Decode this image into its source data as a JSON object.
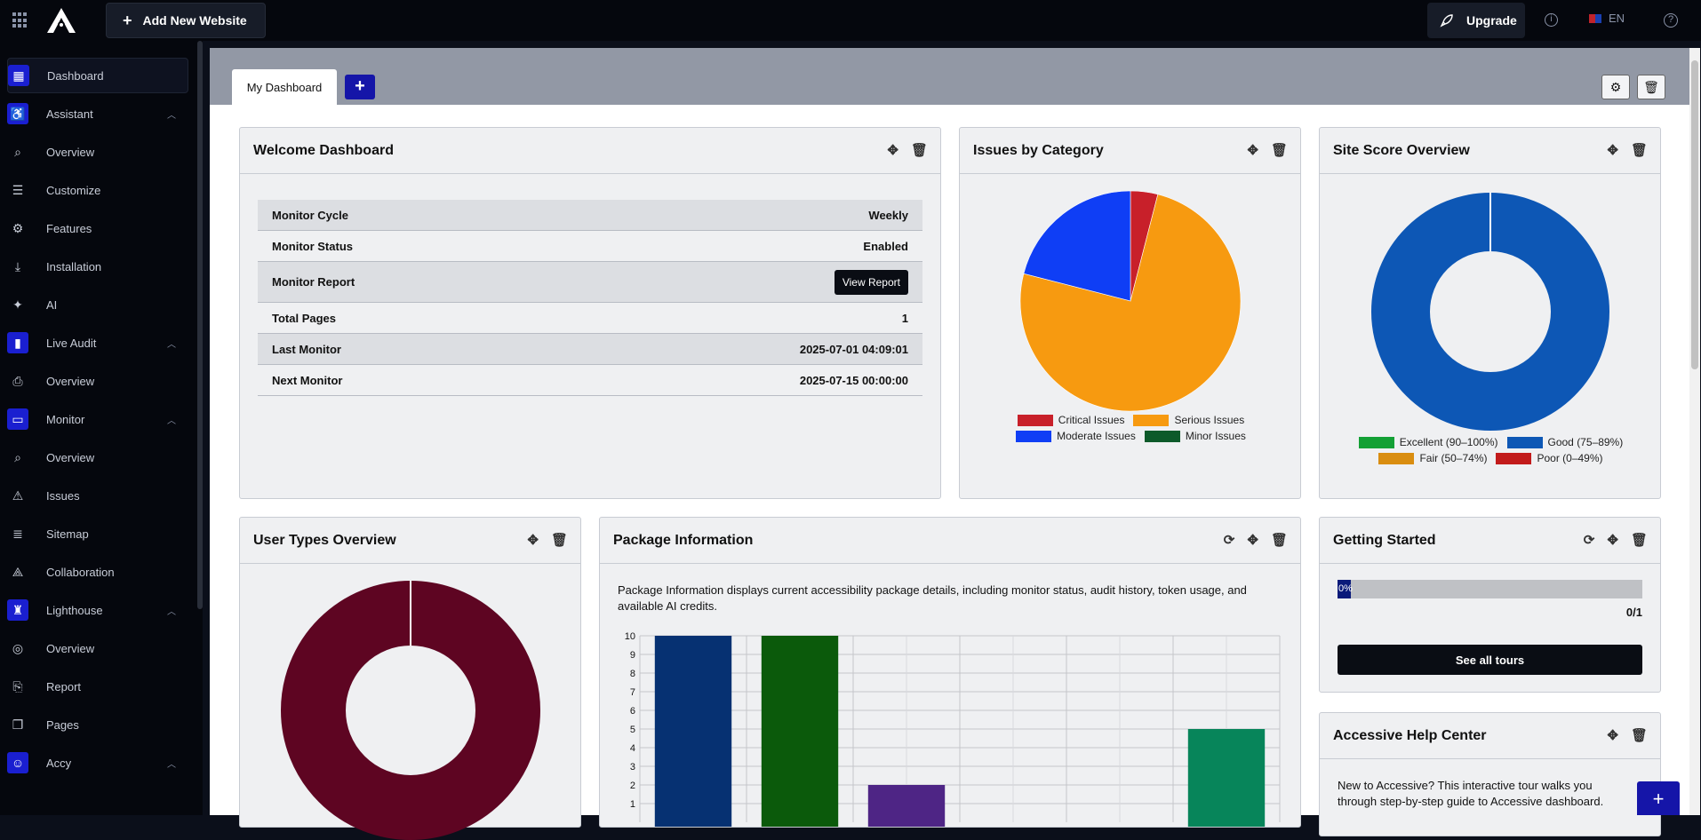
{
  "topbar": {
    "add_website_label": "Add New Website",
    "upgrade_label": "Upgrade",
    "language": "EN"
  },
  "sidebar": {
    "items": [
      {
        "label": "Dashboard",
        "icon": "dashboard-icon",
        "kind": "active"
      },
      {
        "label": "Assistant",
        "icon": "accessibility-icon",
        "kind": "section"
      },
      {
        "label": "Overview",
        "icon": "page-search-icon",
        "kind": "sub"
      },
      {
        "label": "Customize",
        "icon": "sliders-icon",
        "kind": "sub"
      },
      {
        "label": "Features",
        "icon": "gear-icon",
        "kind": "sub"
      },
      {
        "label": "Installation",
        "icon": "install-icon",
        "kind": "sub"
      },
      {
        "label": "AI",
        "icon": "sparkle-icon",
        "kind": "sub"
      },
      {
        "label": "Live Audit",
        "icon": "bar-chart-icon",
        "kind": "section"
      },
      {
        "label": "Overview",
        "icon": "doc-search-icon",
        "kind": "sub"
      },
      {
        "label": "Monitor",
        "icon": "monitor-icon",
        "kind": "section"
      },
      {
        "label": "Overview",
        "icon": "magnify-icon",
        "kind": "sub"
      },
      {
        "label": "Issues",
        "icon": "warning-icon",
        "kind": "sub"
      },
      {
        "label": "Sitemap",
        "icon": "list-icon",
        "kind": "sub"
      },
      {
        "label": "Collaboration",
        "icon": "collab-icon",
        "kind": "sub"
      },
      {
        "label": "Lighthouse",
        "icon": "lighthouse-icon",
        "kind": "section"
      },
      {
        "label": "Overview",
        "icon": "gauge-icon",
        "kind": "sub"
      },
      {
        "label": "Report",
        "icon": "report-icon",
        "kind": "sub"
      },
      {
        "label": "Pages",
        "icon": "pages-icon",
        "kind": "sub"
      },
      {
        "label": "Accy",
        "icon": "robot-icon",
        "kind": "section"
      }
    ]
  },
  "tabs": {
    "active": "My Dashboard"
  },
  "welcome": {
    "title": "Welcome Dashboard",
    "rows": [
      {
        "label": "Monitor Cycle",
        "value": "Weekly"
      },
      {
        "label": "Monitor Status",
        "value": "Enabled"
      },
      {
        "label": "Monitor Report",
        "value": "View Report"
      },
      {
        "label": "Total Pages",
        "value": "1"
      },
      {
        "label": "Last Monitor",
        "value": "2025-07-01 04:09:01"
      },
      {
        "label": "Next Monitor",
        "value": "2025-07-15 00:00:00"
      }
    ]
  },
  "issues_card": {
    "title": "Issues by Category"
  },
  "score_card": {
    "title": "Site Score Overview"
  },
  "user_types_card": {
    "title": "User Types Overview"
  },
  "package_card": {
    "title": "Package Information",
    "description": "Package Information displays current accessibility package details, including monitor status, audit history, token usage, and available AI credits."
  },
  "getting_started": {
    "title": "Getting Started",
    "progress_label": "0%",
    "progress": 0,
    "count": "0/1",
    "button": "See all tours"
  },
  "help_center": {
    "title": "Accessive Help Center",
    "text": "New to Accessive? This interactive tour walks you through step-by-step guide to Accessive dashboard."
  },
  "fab_label": "+",
  "chart_data": [
    {
      "type": "pie",
      "labels": [
        "Critical Issues",
        "Serious Issues",
        "Moderate Issues",
        "Minor Issues"
      ],
      "values": [
        4,
        75,
        21,
        0
      ],
      "colors": [
        "#c8202a",
        "#f79a10",
        "#0f3ef5",
        "#0d5a2a"
      ],
      "legend": "bottom"
    },
    {
      "type": "pie",
      "donut": true,
      "labels": [
        "Excellent (90–100%)",
        "Good (75–89%)",
        "Fair (50–74%)",
        "Poor (0–49%)"
      ],
      "values": [
        0,
        100,
        0,
        0
      ],
      "colors": [
        "#13a035",
        "#0d57b5",
        "#d98d10",
        "#c21b1b"
      ],
      "legend": "bottom"
    },
    {
      "type": "pie",
      "donut": true,
      "labels": [
        ""
      ],
      "values": [
        100
      ],
      "colors": [
        "#5e0522"
      ]
    },
    {
      "type": "bar",
      "categories": [
        "",
        "",
        "",
        "",
        "",
        ""
      ],
      "values": [
        10,
        10,
        2,
        0,
        0,
        5
      ],
      "colors": [
        "#063172",
        "#0b5a0b",
        "#4e2585",
        "#888888",
        "#888888",
        "#07855a"
      ],
      "yticks": [
        1,
        2,
        3,
        4,
        5,
        6,
        7,
        8,
        9,
        10
      ],
      "ylim": [
        0,
        10
      ],
      "grid": true
    }
  ]
}
